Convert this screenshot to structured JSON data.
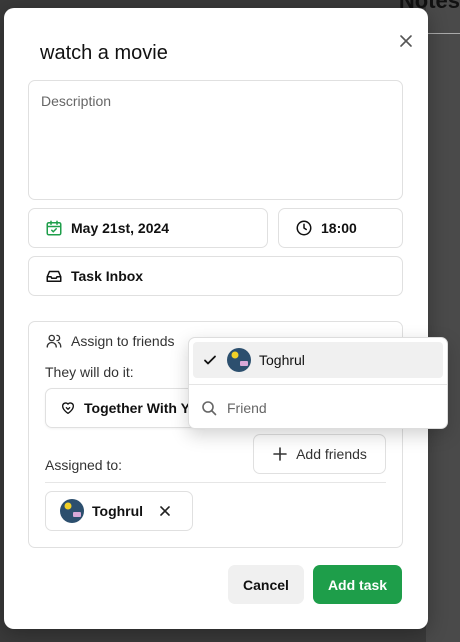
{
  "background": {
    "partial_title": "Notes"
  },
  "modal": {
    "title": "watch a movie",
    "description_placeholder": "Description",
    "date": "May 21st, 2024",
    "time": "18:00",
    "project": "Task Inbox",
    "assign": {
      "header": "Assign to friends",
      "they_will_label": "They will do it:",
      "mode_value": "Together With Yo",
      "add_friends_label": "Add friends",
      "assigned_label": "Assigned to:",
      "assignees": [
        {
          "name": "Toghrul"
        }
      ]
    },
    "buttons": {
      "cancel": "Cancel",
      "add_task": "Add task"
    }
  },
  "dropdown": {
    "options": [
      {
        "name": "Toghrul",
        "selected": true
      }
    ],
    "search_placeholder": "Friend"
  },
  "icons": {
    "close": "close-icon",
    "calendar": "calendar-icon",
    "clock": "clock-icon",
    "inbox": "inbox-icon",
    "users": "users-icon",
    "heart-handshake": "heart-icon",
    "plus": "plus-icon",
    "check": "check-icon",
    "search": "search-icon",
    "remove": "close-icon"
  },
  "colors": {
    "accent_green": "#1e9e4a",
    "calendar_green": "#1e9e4a",
    "cancel_bg": "#f0f0f0"
  }
}
